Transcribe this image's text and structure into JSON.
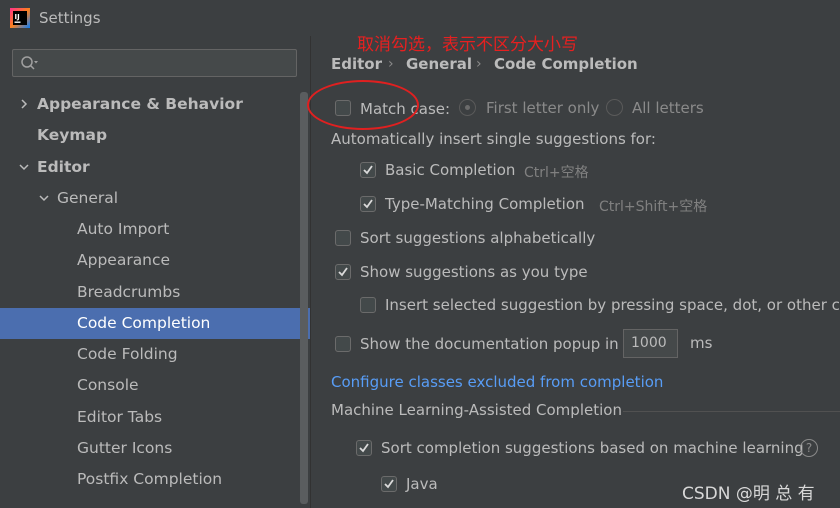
{
  "window": {
    "title": "Settings"
  },
  "search": {
    "placeholder": ""
  },
  "tree": {
    "items": [
      {
        "label": "Appearance & Behavior",
        "level": 0,
        "bold": true,
        "chevron": "right"
      },
      {
        "label": "Keymap",
        "level": 0,
        "bold": true,
        "chevron": "none"
      },
      {
        "label": "Editor",
        "level": 0,
        "bold": true,
        "chevron": "down"
      },
      {
        "label": "General",
        "level": 1,
        "bold": false,
        "chevron": "down"
      },
      {
        "label": "Auto Import",
        "level": 2,
        "bold": false,
        "chevron": "none"
      },
      {
        "label": "Appearance",
        "level": 2,
        "bold": false,
        "chevron": "none"
      },
      {
        "label": "Breadcrumbs",
        "level": 2,
        "bold": false,
        "chevron": "none"
      },
      {
        "label": "Code Completion",
        "level": 2,
        "bold": false,
        "chevron": "none",
        "selected": true
      },
      {
        "label": "Code Folding",
        "level": 2,
        "bold": false,
        "chevron": "none"
      },
      {
        "label": "Console",
        "level": 2,
        "bold": false,
        "chevron": "none"
      },
      {
        "label": "Editor Tabs",
        "level": 2,
        "bold": false,
        "chevron": "none"
      },
      {
        "label": "Gutter Icons",
        "level": 2,
        "bold": false,
        "chevron": "none"
      },
      {
        "label": "Postfix Completion",
        "level": 2,
        "bold": false,
        "chevron": "none"
      }
    ]
  },
  "breadcrumb": [
    "Editor",
    "General",
    "Code Completion"
  ],
  "options": {
    "match_case": {
      "label": "Match case:",
      "checked": false
    },
    "first_letter_only": {
      "label": "First letter only",
      "selected": true
    },
    "all_letters": {
      "label": "All letters",
      "selected": false
    },
    "auto_insert_heading": "Automatically insert single suggestions for:",
    "basic_completion": {
      "label": "Basic Completion",
      "checked": true,
      "shortcut": "Ctrl+空格"
    },
    "type_matching": {
      "label": "Type-Matching Completion",
      "checked": true,
      "shortcut": "Ctrl+Shift+空格"
    },
    "sort_alpha": {
      "label": "Sort suggestions alphabetically",
      "checked": false
    },
    "show_as_type": {
      "label": "Show suggestions as you type",
      "checked": true
    },
    "insert_selected": {
      "label": "Insert selected suggestion by pressing space, dot, or other con",
      "checked": false
    },
    "doc_popup": {
      "label": "Show the documentation popup in",
      "checked": false,
      "value": "1000",
      "unit": "ms"
    },
    "configure_link": "Configure classes excluded from completion",
    "ml_heading": "Machine Learning-Assisted Completion",
    "ml_sort": {
      "label": "Sort completion suggestions based on machine learning",
      "checked": true
    },
    "java": {
      "label": "Java",
      "checked": true
    }
  },
  "annotation": {
    "text": "取消勾选，表示不区分大小写",
    "color": "#e62020"
  },
  "watermark": "CSDN @明 总 有",
  "colors": {
    "background": "#3c3f41",
    "selection": "#4b6eaf",
    "link": "#589df6",
    "text": "#bbbbbb"
  }
}
